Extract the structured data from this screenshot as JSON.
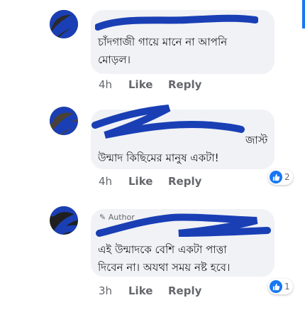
{
  "comments": [
    {
      "text": "চাঁদগাজী গায়ে মানে না আপনি\nমোড়ল।",
      "time": "4h",
      "like_label": "Like",
      "reply_label": "Reply"
    },
    {
      "text_partial": "জাস্ট",
      "text": "উন্মাদ কিছিমের মানুষ একটা!",
      "time": "4h",
      "like_label": "Like",
      "reply_label": "Reply",
      "reaction_count": "2"
    },
    {
      "badge": "Author",
      "text": "এই উন্মাদকে বেশি একটা পাত্তা\nদিবেন না। অযথা সময় নষ্ট হবে।",
      "time": "3h",
      "like_label": "Like",
      "reply_label": "Reply",
      "reaction_count": "1"
    }
  ],
  "colors": {
    "bubble": "#f0f2f5",
    "meta_text": "#65676b",
    "like_blue": "#1877f2",
    "redaction_blue": "#1a3fb5"
  }
}
